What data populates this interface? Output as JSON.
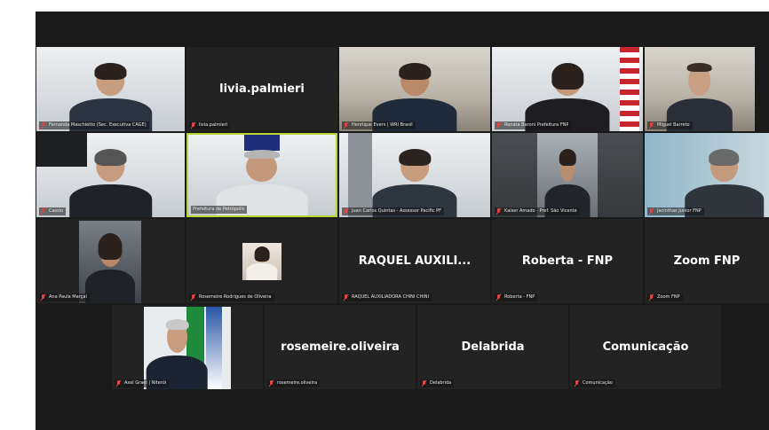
{
  "meeting": {
    "participants": [
      {
        "id": "p1",
        "caption": "Fernanda Maschietto (Sec. Executiva CAGE)",
        "video": true
      },
      {
        "id": "p2",
        "display_name": "livia.palmieri",
        "caption": "livia.palmieri",
        "video": false
      },
      {
        "id": "p3",
        "caption": "Henrique Evers | WRI Brasil",
        "video": true
      },
      {
        "id": "p4",
        "caption": "Renata Baroni Prefeitura FNP",
        "video": true
      },
      {
        "id": "p5",
        "caption": "Miguel Barreto",
        "video": true
      },
      {
        "id": "p6",
        "caption": "Cassio",
        "video": true
      },
      {
        "id": "p7",
        "caption": "Prefeitura de Petrópolis",
        "video": true,
        "active_speaker": true
      },
      {
        "id": "p8",
        "caption": "Juan Carlos Quintas - Assessor Pacific PF",
        "video": true
      },
      {
        "id": "p9",
        "caption": "Kaiser Amado - Pref. São Vicente",
        "video": true
      },
      {
        "id": "p10",
        "caption": "Jacinthas Junior FNP",
        "video": true
      },
      {
        "id": "p11",
        "caption": "Ana Paula Marçal",
        "video": true
      },
      {
        "id": "p12",
        "caption": "Rosemeire Rodrigues de Oliveira",
        "video": false,
        "has_photo": true
      },
      {
        "id": "p13",
        "display_name": "RAQUEL AUXILI...",
        "caption": "RAQUEL AUXILIADORA CHINI CHINI",
        "video": false
      },
      {
        "id": "p14",
        "display_name": "Roberta - FNP",
        "caption": "Roberta - FNP",
        "video": false
      },
      {
        "id": "p15",
        "display_name": "Zoom FNP",
        "caption": "Zoom FNP",
        "video": false
      },
      {
        "id": "p16",
        "caption": "Axel Grael | Niterói",
        "video": true
      },
      {
        "id": "p17",
        "display_name": "rosemeire.oliveira",
        "caption": "rosemeire.oliveira",
        "video": false
      },
      {
        "id": "p18",
        "display_name": "Delabrida",
        "caption": "Delabrida",
        "video": false
      },
      {
        "id": "p19",
        "display_name": "Comunicação",
        "caption": "Comunicação",
        "video": false
      }
    ]
  },
  "colors": {
    "active_speaker_border": "#b7d436",
    "muted_icon": "#e04444",
    "tile_bg": "#232323",
    "app_bg": "#1a1a1a"
  }
}
